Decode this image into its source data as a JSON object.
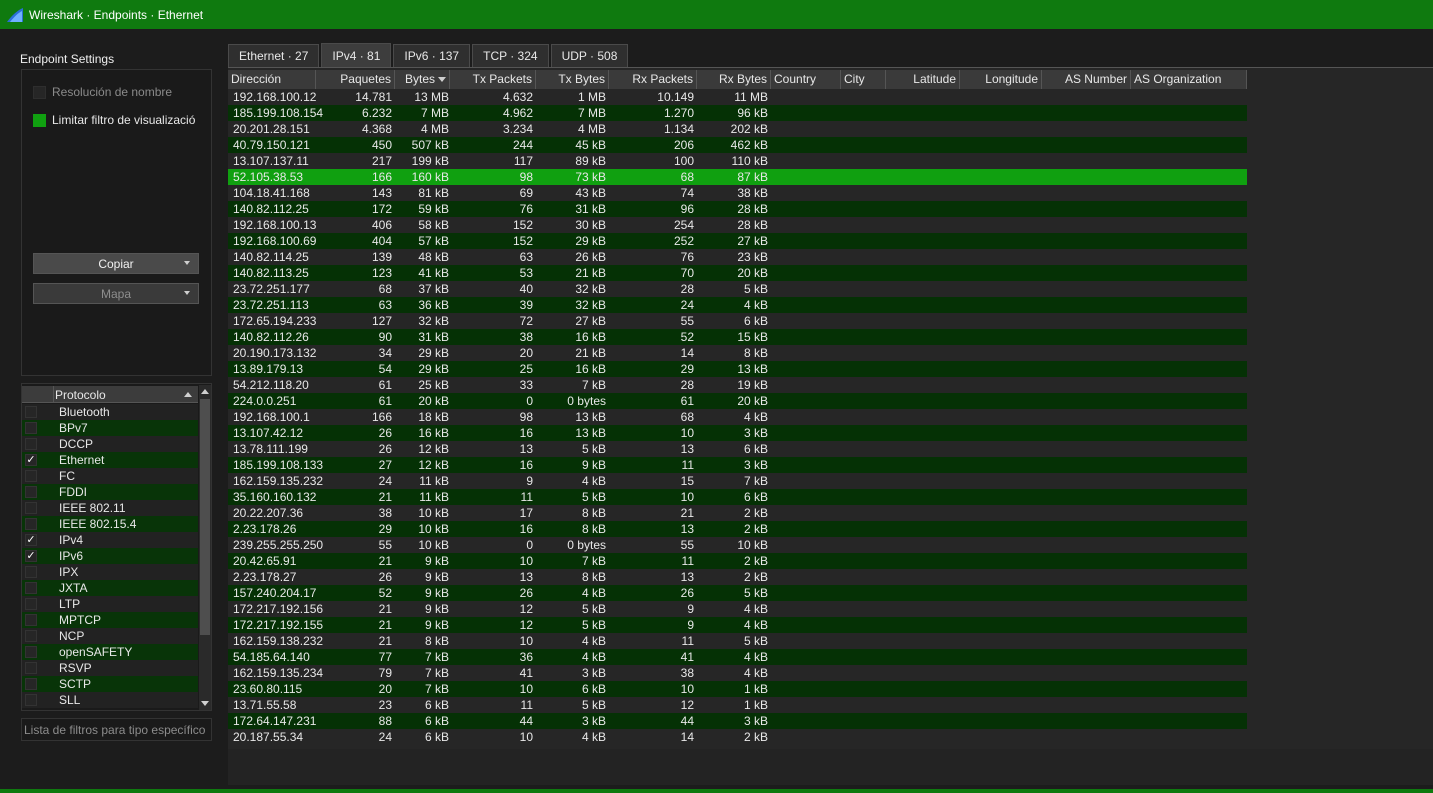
{
  "window": {
    "title": "Wireshark · Endpoints · Ethernet"
  },
  "settings": {
    "heading": "Endpoint Settings",
    "name_resolution_label": "Resolución de nombre",
    "limit_filter_label": "Limitar filtro de visualizació",
    "copy_label": "Copiar",
    "map_label": "Mapa"
  },
  "protocol_list": {
    "header": "Protocolo",
    "items": [
      {
        "label": "Bluetooth",
        "checked": false
      },
      {
        "label": "BPv7",
        "checked": false
      },
      {
        "label": "DCCP",
        "checked": false
      },
      {
        "label": "Ethernet",
        "checked": true
      },
      {
        "label": "FC",
        "checked": false
      },
      {
        "label": "FDDI",
        "checked": false
      },
      {
        "label": "IEEE 802.11",
        "checked": false
      },
      {
        "label": "IEEE 802.15.4",
        "checked": false
      },
      {
        "label": "IPv4",
        "checked": true
      },
      {
        "label": "IPv6",
        "checked": true
      },
      {
        "label": "IPX",
        "checked": false
      },
      {
        "label": "JXTA",
        "checked": false
      },
      {
        "label": "LTP",
        "checked": false
      },
      {
        "label": "MPTCP",
        "checked": false
      },
      {
        "label": "NCP",
        "checked": false
      },
      {
        "label": "openSAFETY",
        "checked": false
      },
      {
        "label": "RSVP",
        "checked": false
      },
      {
        "label": "SCTP",
        "checked": false
      },
      {
        "label": "SLL",
        "checked": false
      }
    ],
    "filter_placeholder": "Lista de filtros para tipo específico"
  },
  "tabs": [
    {
      "label": "Ethernet · 27",
      "active": false
    },
    {
      "label": "IPv4 · 81",
      "active": true
    },
    {
      "label": "IPv6 · 137",
      "active": false
    },
    {
      "label": "TCP · 324",
      "active": false
    },
    {
      "label": "UDP · 508",
      "active": false
    }
  ],
  "table": {
    "columns": [
      "Dirección",
      "Paquetes",
      "Bytes",
      "Tx Packets",
      "Tx Bytes",
      "Rx Packets",
      "Rx Bytes",
      "Country",
      "City",
      "Latitude",
      "Longitude",
      "AS Number",
      "AS Organization"
    ],
    "selected_row": 5,
    "rows": [
      [
        "192.168.100.12",
        "14.781",
        "13 MB",
        "4.632",
        "1 MB",
        "10.149",
        "11 MB"
      ],
      [
        "185.199.108.154",
        "6.232",
        "7 MB",
        "4.962",
        "7 MB",
        "1.270",
        "96 kB"
      ],
      [
        "20.201.28.151",
        "4.368",
        "4 MB",
        "3.234",
        "4 MB",
        "1.134",
        "202 kB"
      ],
      [
        "40.79.150.121",
        "450",
        "507 kB",
        "244",
        "45 kB",
        "206",
        "462 kB"
      ],
      [
        "13.107.137.11",
        "217",
        "199 kB",
        "117",
        "89 kB",
        "100",
        "110 kB"
      ],
      [
        "52.105.38.53",
        "166",
        "160 kB",
        "98",
        "73 kB",
        "68",
        "87 kB"
      ],
      [
        "104.18.41.168",
        "143",
        "81 kB",
        "69",
        "43 kB",
        "74",
        "38 kB"
      ],
      [
        "140.82.112.25",
        "172",
        "59 kB",
        "76",
        "31 kB",
        "96",
        "28 kB"
      ],
      [
        "192.168.100.13",
        "406",
        "58 kB",
        "152",
        "30 kB",
        "254",
        "28 kB"
      ],
      [
        "192.168.100.69",
        "404",
        "57 kB",
        "152",
        "29 kB",
        "252",
        "27 kB"
      ],
      [
        "140.82.114.25",
        "139",
        "48 kB",
        "63",
        "26 kB",
        "76",
        "23 kB"
      ],
      [
        "140.82.113.25",
        "123",
        "41 kB",
        "53",
        "21 kB",
        "70",
        "20 kB"
      ],
      [
        "23.72.251.177",
        "68",
        "37 kB",
        "40",
        "32 kB",
        "28",
        "5 kB"
      ],
      [
        "23.72.251.113",
        "63",
        "36 kB",
        "39",
        "32 kB",
        "24",
        "4 kB"
      ],
      [
        "172.65.194.233",
        "127",
        "32 kB",
        "72",
        "27 kB",
        "55",
        "6 kB"
      ],
      [
        "140.82.112.26",
        "90",
        "31 kB",
        "38",
        "16 kB",
        "52",
        "15 kB"
      ],
      [
        "20.190.173.132",
        "34",
        "29 kB",
        "20",
        "21 kB",
        "14",
        "8 kB"
      ],
      [
        "13.89.179.13",
        "54",
        "29 kB",
        "25",
        "16 kB",
        "29",
        "13 kB"
      ],
      [
        "54.212.118.20",
        "61",
        "25 kB",
        "33",
        "7 kB",
        "28",
        "19 kB"
      ],
      [
        "224.0.0.251",
        "61",
        "20 kB",
        "0",
        "0 bytes",
        "61",
        "20 kB"
      ],
      [
        "192.168.100.1",
        "166",
        "18 kB",
        "98",
        "13 kB",
        "68",
        "4 kB"
      ],
      [
        "13.107.42.12",
        "26",
        "16 kB",
        "16",
        "13 kB",
        "10",
        "3 kB"
      ],
      [
        "13.78.111.199",
        "26",
        "12 kB",
        "13",
        "5 kB",
        "13",
        "6 kB"
      ],
      [
        "185.199.108.133",
        "27",
        "12 kB",
        "16",
        "9 kB",
        "11",
        "3 kB"
      ],
      [
        "162.159.135.232",
        "24",
        "11 kB",
        "9",
        "4 kB",
        "15",
        "7 kB"
      ],
      [
        "35.160.160.132",
        "21",
        "11 kB",
        "11",
        "5 kB",
        "10",
        "6 kB"
      ],
      [
        "20.22.207.36",
        "38",
        "10 kB",
        "17",
        "8 kB",
        "21",
        "2 kB"
      ],
      [
        "2.23.178.26",
        "29",
        "10 kB",
        "16",
        "8 kB",
        "13",
        "2 kB"
      ],
      [
        "239.255.255.250",
        "55",
        "10 kB",
        "0",
        "0 bytes",
        "55",
        "10 kB"
      ],
      [
        "20.42.65.91",
        "21",
        "9 kB",
        "10",
        "7 kB",
        "11",
        "2 kB"
      ],
      [
        "2.23.178.27",
        "26",
        "9 kB",
        "13",
        "8 kB",
        "13",
        "2 kB"
      ],
      [
        "157.240.204.17",
        "52",
        "9 kB",
        "26",
        "4 kB",
        "26",
        "5 kB"
      ],
      [
        "172.217.192.156",
        "21",
        "9 kB",
        "12",
        "5 kB",
        "9",
        "4 kB"
      ],
      [
        "172.217.192.155",
        "21",
        "9 kB",
        "12",
        "5 kB",
        "9",
        "4 kB"
      ],
      [
        "162.159.138.232",
        "21",
        "8 kB",
        "10",
        "4 kB",
        "11",
        "5 kB"
      ],
      [
        "54.185.64.140",
        "77",
        "7 kB",
        "36",
        "4 kB",
        "41",
        "4 kB"
      ],
      [
        "162.159.135.234",
        "79",
        "7 kB",
        "41",
        "3 kB",
        "38",
        "4 kB"
      ],
      [
        "23.60.80.115",
        "20",
        "7 kB",
        "10",
        "6 kB",
        "10",
        "1 kB"
      ],
      [
        "13.71.55.58",
        "23",
        "6 kB",
        "11",
        "5 kB",
        "12",
        "1 kB"
      ],
      [
        "172.64.147.231",
        "88",
        "6 kB",
        "44",
        "3 kB",
        "44",
        "3 kB"
      ],
      [
        "20.187.55.34",
        "24",
        "6 kB",
        "10",
        "4 kB",
        "14",
        "2 kB"
      ]
    ]
  },
  "colors": {
    "title_bar": "#0f7a0f",
    "selected_row": "#10a010",
    "alt_row_green": "#053105",
    "row_dark": "#262626"
  }
}
